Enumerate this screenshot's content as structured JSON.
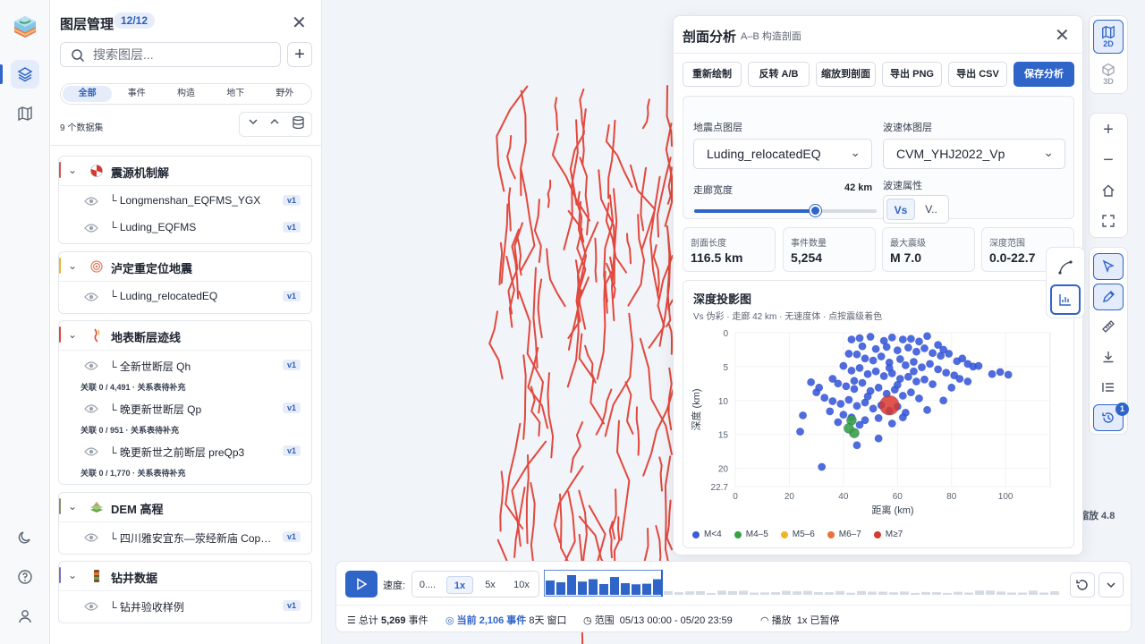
{
  "layers_panel": {
    "title": "图层管理",
    "count": "12/12",
    "search_placeholder": "搜索图层...",
    "filters": [
      "全部",
      "事件",
      "构造",
      "地下",
      "野外"
    ],
    "dataset_count": "9 个数据集",
    "groups": [
      {
        "title": "震源机制解",
        "color": "#d9534f",
        "items": [
          {
            "name": "└ Longmenshan_EQFMS_YGX",
            "badge": "v1"
          },
          {
            "name": "└ Luding_EQFMS",
            "badge": "v1"
          }
        ]
      },
      {
        "title": "泸定重定位地震",
        "color": "#f0b429",
        "items": [
          {
            "name": "└ Luding_relocatedEQ",
            "badge": "v1"
          }
        ]
      },
      {
        "title": "地表断层迹线",
        "color": "#e2483d",
        "items": [
          {
            "name": "└ 全新世断层 Qh",
            "badge": "v1",
            "relation": "关联 0 / 4,491 · 关系表待补充"
          },
          {
            "name": "└ 晚更新世断层 Qp",
            "badge": "v1",
            "relation": "关联 0 / 951 · 关系表待补充"
          },
          {
            "name": "└ 晚更新世之前断层 preQp3",
            "badge": "v1",
            "relation": "关联 0 / 1,770 · 关系表待补充"
          }
        ]
      },
      {
        "title": "DEM 高程",
        "color": "#8c8f6a",
        "items": [
          {
            "name": "└ 四川雅安宜东—荥经新庙 Cope...",
            "badge": "v1"
          }
        ]
      },
      {
        "title": "钻井数据",
        "color": "#7a6fc9",
        "items": [
          {
            "name": "└ 钻井验收样例",
            "badge": "v1"
          }
        ]
      }
    ]
  },
  "toolbar": {
    "mode_2d": "2D",
    "mode_3d": "3D",
    "history_badge": "1",
    "scale_text": "缩放 4.8"
  },
  "analysis": {
    "title": "剖面分析",
    "subtitle": "A–B 构造剖面",
    "buttons": [
      "重新绘制",
      "反转 A/B",
      "缩放到剖面",
      "导出 PNG",
      "导出 CSV",
      "保存分析"
    ],
    "eq_layer_label": "地震点图层",
    "eq_layer_value": "Luding_relocatedEQ",
    "vel_layer_label": "波速体图层",
    "vel_layer_value": "CVM_YHJ2022_Vp",
    "corridor_label": "走廊宽度",
    "corridor_value": "42 km",
    "corridor_fraction": 0.66,
    "vel_attr_label": "波速属性",
    "vel_attr_options": [
      "Vs",
      "V.."
    ],
    "stats": [
      {
        "label": "剖面长度",
        "value": "116.5 km"
      },
      {
        "label": "事件数量",
        "value": "5,254"
      },
      {
        "label": "最大震级",
        "value": "M 7.0"
      },
      {
        "label": "深度范围",
        "value": "0.0-22.7"
      }
    ],
    "plot_title": "深度投影图",
    "plot_subtitle": "Vs 伪彩 · 走廊 42 km · 无速度体 · 点按震级着色",
    "legend": [
      {
        "label": "M<4",
        "color": "#3b5bdb"
      },
      {
        "label": "M4–5",
        "color": "#37a046"
      },
      {
        "label": "M5–6",
        "color": "#f0b429"
      },
      {
        "label": "M6–7",
        "color": "#e8733a"
      },
      {
        "label": "M≥7",
        "color": "#d9382f"
      }
    ]
  },
  "chart_data": {
    "type": "scatter",
    "xlabel": "距离 (km)",
    "ylabel": "深度 (km)",
    "xlim": [
      0,
      116.5
    ],
    "ylim": [
      0,
      22.7
    ],
    "x_ticks": [
      0,
      20,
      40,
      60,
      80,
      100
    ],
    "y_ticks": [
      0,
      5,
      10,
      15,
      20,
      22.7
    ],
    "series": [
      {
        "name": "M<4",
        "color": "#3b5bdb",
        "points": [
          [
            43,
            1
          ],
          [
            46,
            0.8
          ],
          [
            50,
            0.6
          ],
          [
            55,
            1.2
          ],
          [
            58,
            0.7
          ],
          [
            62,
            1
          ],
          [
            65,
            0.9
          ],
          [
            68,
            1.3
          ],
          [
            71,
            0.5
          ],
          [
            47,
            2
          ],
          [
            52,
            2.4
          ],
          [
            56,
            2.1
          ],
          [
            60,
            2.6
          ],
          [
            64,
            2.2
          ],
          [
            67,
            2.8
          ],
          [
            70,
            2.3
          ],
          [
            73,
            3
          ],
          [
            76,
            3.4
          ],
          [
            79,
            3.1
          ],
          [
            82,
            4.2
          ],
          [
            84,
            3.8
          ],
          [
            86,
            4.6
          ],
          [
            88,
            5
          ],
          [
            98,
            5.8
          ],
          [
            101,
            6.2
          ],
          [
            45,
            3.2
          ],
          [
            48,
            3.8
          ],
          [
            51,
            4.1
          ],
          [
            54,
            3.5
          ],
          [
            57,
            4.4
          ],
          [
            61,
            3.9
          ],
          [
            63,
            4.8
          ],
          [
            66,
            4.3
          ],
          [
            69,
            5.1
          ],
          [
            72,
            4.6
          ],
          [
            75,
            5.4
          ],
          [
            78,
            5.9
          ],
          [
            81,
            6.3
          ],
          [
            40,
            4.9
          ],
          [
            43,
            5.6
          ],
          [
            46,
            5.2
          ],
          [
            49,
            6.1
          ],
          [
            52,
            5.7
          ],
          [
            55,
            6.4
          ],
          [
            58,
            6
          ],
          [
            61,
            6.8
          ],
          [
            64,
            6.5
          ],
          [
            67,
            7.2
          ],
          [
            70,
            6.9
          ],
          [
            73,
            7.6
          ],
          [
            36,
            6.8
          ],
          [
            38,
            7.5
          ],
          [
            41,
            7.9
          ],
          [
            44,
            8.3
          ],
          [
            47,
            7.4
          ],
          [
            50,
            8.6
          ],
          [
            53,
            8.1
          ],
          [
            56,
            9
          ],
          [
            59,
            8.4
          ],
          [
            62,
            9.3
          ],
          [
            65,
            8.8
          ],
          [
            68,
            9.7
          ],
          [
            30,
            8.8
          ],
          [
            33,
            9.6
          ],
          [
            36,
            10.1
          ],
          [
            39,
            10.5
          ],
          [
            42,
            9.9
          ],
          [
            45,
            10.8
          ],
          [
            48,
            10.3
          ],
          [
            51,
            11.2
          ],
          [
            54,
            10.7
          ],
          [
            57,
            11.5
          ],
          [
            60,
            10.9
          ],
          [
            63,
            11.8
          ],
          [
            71,
            11.4
          ],
          [
            77,
            10
          ],
          [
            80,
            8.1
          ],
          [
            25,
            12.2
          ],
          [
            35,
            11.6
          ],
          [
            40,
            12.1
          ],
          [
            43,
            12.5
          ],
          [
            38,
            13.2
          ],
          [
            46,
            13.6
          ],
          [
            24,
            14.6
          ],
          [
            45,
            16.6
          ],
          [
            53,
            15.6
          ],
          [
            58,
            13.4
          ],
          [
            32,
            19.8
          ],
          [
            28,
            7.3
          ],
          [
            31,
            8.1
          ],
          [
            86,
            7.2
          ],
          [
            83,
            6.8
          ],
          [
            90,
            4.9
          ],
          [
            95,
            6.1
          ],
          [
            42,
            3.1
          ],
          [
            75,
            1.8
          ],
          [
            77,
            2.5
          ],
          [
            44,
            7.1
          ],
          [
            57,
            5.2
          ],
          [
            66,
            5.7
          ],
          [
            60,
            7.7
          ],
          [
            49,
            9.4
          ],
          [
            53,
            12.6
          ],
          [
            62,
            12.5
          ],
          [
            48,
            12.9
          ]
        ]
      },
      {
        "name": "M4–5",
        "color": "#37a046",
        "points": [
          [
            43,
            12.9
          ],
          [
            44,
            14.8
          ],
          [
            42,
            14.1
          ]
        ]
      },
      {
        "name": "M≥7",
        "color": "#d9382f",
        "points": [
          [
            57,
            10.7
          ]
        ]
      }
    ]
  }
}
